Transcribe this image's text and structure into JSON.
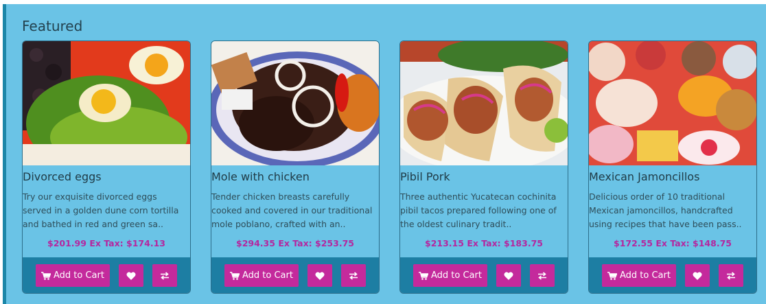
{
  "section": {
    "title": "Featured"
  },
  "products": [
    {
      "name": "Divorced eggs",
      "description": "Try our exquisite divorced eggs served in a golden dune corn tortilla and bathed in red and green sa..",
      "price": "$201.99",
      "ex_tax": "Ex Tax: $174.13",
      "image_icon": "divorced-eggs-photo"
    },
    {
      "name": "Mole with chicken",
      "description": "Tender chicken breasts carefully cooked and covered in our traditional mole poblano, crafted with an..",
      "price": "$294.35",
      "ex_tax": "Ex Tax: $253.75",
      "image_icon": "mole-chicken-photo"
    },
    {
      "name": "Pibil Pork",
      "description": "Three authentic Yucatecan cochinita pibil tacos prepared following one of the oldest culinary tradit..",
      "price": "$213.15",
      "ex_tax": "Ex Tax: $183.75",
      "image_icon": "pibil-pork-photo"
    },
    {
      "name": "Mexican Jamoncillos",
      "description": "Delicious order of 10 traditional Mexican jamoncillos, handcrafted using recipes that have been pass..",
      "price": "$172.55",
      "ex_tax": "Ex Tax: $148.75",
      "image_icon": "jamoncillos-photo"
    }
  ],
  "buttons": {
    "add_to_cart": "Add to Cart",
    "cart_icon": "cart-icon",
    "wishlist_icon": "heart-icon",
    "compare_icon": "compare-arrows-icon"
  },
  "colors": {
    "panel_bg": "#6ac3e6",
    "footer_bg": "#1d7ea3",
    "button_bg": "#c42a9c",
    "price_text": "#b5269f"
  }
}
